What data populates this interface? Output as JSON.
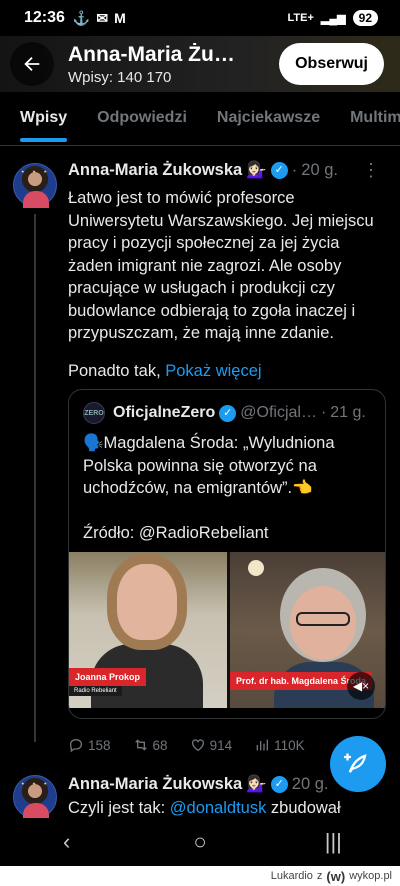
{
  "status_bar": {
    "time": "12:36",
    "network": "LTE+",
    "battery": "92"
  },
  "header": {
    "title": "Anna-Maria Żu…",
    "posts_label": "Wpisy: 140 170",
    "follow_label": "Obserwuj"
  },
  "tabs": [
    "Wpisy",
    "Odpowiedzi",
    "Najciekawsze",
    "Multimedia"
  ],
  "post1": {
    "author": "Anna-Maria Żukowska",
    "emoji": "💁🏻‍♀️",
    "separator": "·",
    "time": "20 g.",
    "text": "Łatwo jest to mówić profesorce Uniwersytetu Warszawskiego. Jej miejscu pracy i pozycji społecznej za jej życia żaden imigrant nie zagrozi. Ale osoby pracujące w usługach i produkcji czy budowlance odbierają to zgoła inaczej i przypuszczam, że mają inne zdanie.",
    "more_prefix": "Ponadto tak, ",
    "more_link": "Pokaż więcej"
  },
  "quote": {
    "author": "OficjalneZero",
    "handle": "@Oficjal…",
    "separator": "·",
    "time": "21 g.",
    "emoji": "🗣️",
    "text": "Magdalena Środa: „Wyludniona Polska powinna się otworzyć na uchodźców, na emigrantów”.",
    "end_emoji": "👈",
    "source": "Źródło: @RadioRebeliant",
    "media": {
      "left_name": "Joanna Prokop",
      "left_sub": "Radio Rebeliant",
      "right_name": "Prof. dr hab. Magdalena Środa"
    }
  },
  "actions": {
    "replies": "158",
    "reposts": "68",
    "likes": "914",
    "views": "110K"
  },
  "post2": {
    "author": "Anna-Maria Żukowska",
    "emoji": "💁🏻‍♀️",
    "time": "20 g.",
    "text_prefix": "Czyli jest tak: ",
    "mention": "@donaldtusk",
    "text_suffix": " zbudował"
  },
  "watermark": {
    "user": "Lukardio",
    "connector": "z",
    "site": "wykop.pl"
  },
  "colors": {
    "accent": "#1d9bf0",
    "background": "#000000",
    "text": "#e7e9ea",
    "muted": "#71767b"
  }
}
